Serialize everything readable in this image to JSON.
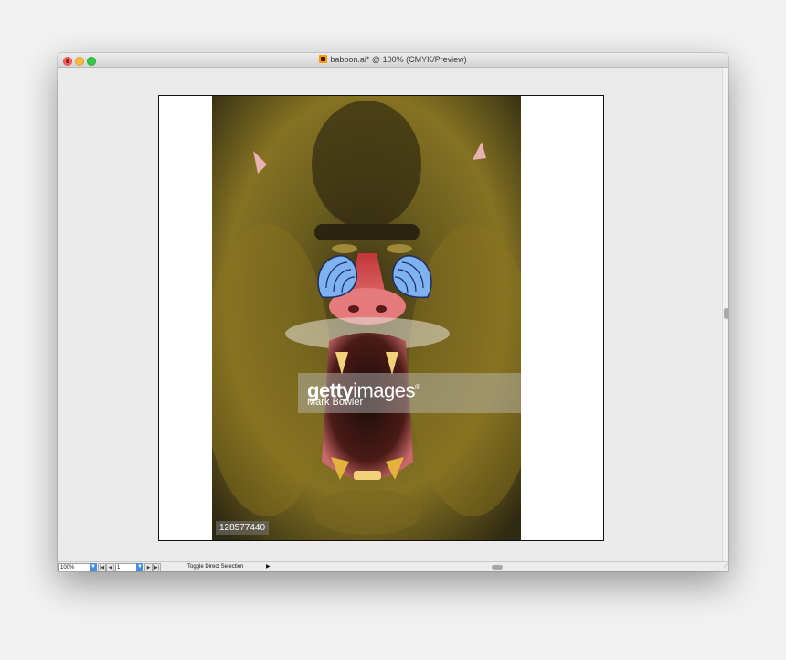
{
  "window": {
    "title": "baboon.ai* @ 100% (CMYK/Preview)"
  },
  "artwork": {
    "watermark_brand_bold": "getty",
    "watermark_brand_light": "images",
    "watermark_reg": "®",
    "watermark_credit": "Mark Bowler",
    "image_id": "128577440"
  },
  "statusbar": {
    "zoom_value": "100%",
    "page_value": "1",
    "status_label": "Toggle Direct Selection",
    "first_page_glyph": "|◀",
    "prev_page_glyph": "◀",
    "next_page_glyph": "▶",
    "last_page_glyph": "▶|",
    "dropdown_glyph": "▼",
    "status_menu_glyph": "▶",
    "resize_glyph": "⟋"
  },
  "colors": {
    "close": "#fc605c",
    "minimize": "#fdbc40",
    "maximize": "#34c84a",
    "accent": "#4a90d9",
    "drawn_shape_fill": "#7fb3f0",
    "drawn_shape_stroke": "#1a2a6c"
  },
  "icons": {
    "document": "illustrator-doc-icon"
  }
}
